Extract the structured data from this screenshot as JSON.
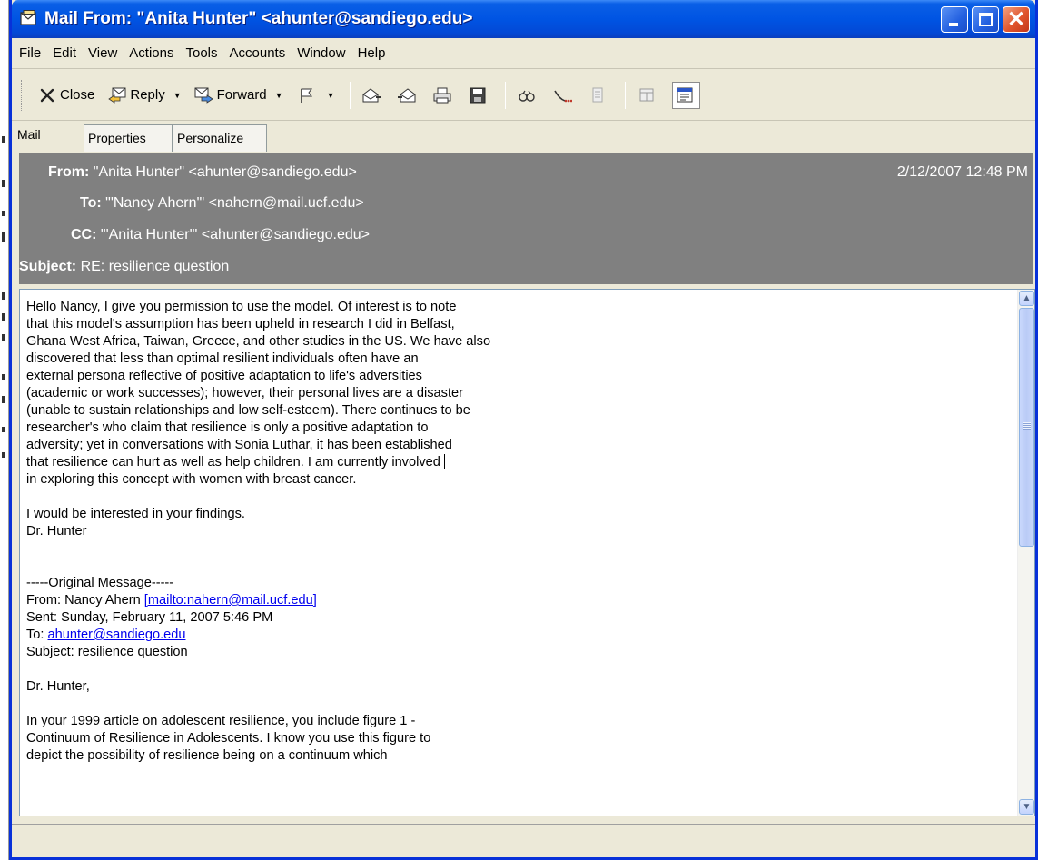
{
  "window": {
    "title": "Mail From: \"Anita Hunter\" <ahunter@sandiego.edu>",
    "close_glyph": "✕"
  },
  "menu": [
    "File",
    "Edit",
    "View",
    "Actions",
    "Tools",
    "Accounts",
    "Window",
    "Help"
  ],
  "toolbar": {
    "close_label": "Close",
    "reply_label": "Reply",
    "forward_label": "Forward"
  },
  "tabs": [
    "Mail",
    "Properties",
    "Personalize"
  ],
  "header": {
    "from_label": "From:",
    "from_value": "\"Anita Hunter\" <ahunter@sandiego.edu>",
    "to_label": "To:",
    "to_value": "\"'Nancy Ahern'\" <nahern@mail.ucf.edu>",
    "cc_label": "CC:",
    "cc_value": "\"'Anita Hunter'\" <ahunter@sandiego.edu>",
    "subject_label": "Subject:",
    "subject_value": "RE: resilience question",
    "date": "2/12/2007 12:48 PM"
  },
  "message": {
    "paragraph1": "Hello Nancy, I give you permission to use the model. Of interest is to note\nthat this model's assumption has been upheld in research I did in Belfast,\nGhana West Africa, Taiwan, Greece, and other studies in the US. We have also\ndiscovered that less than optimal resilient individuals often have an\nexternal persona reflective of positive adaptation to life's adversities\n(academic or work successes); however, their personal lives are a disaster\n(unable to sustain relationships and low self-esteem). There continues to be\nresearcher's who claim that resilience is only a positive adaptation to\nadversity; yet in conversations with Sonia Luthar, it has been established\nthat resilience can hurt as well as help children. I am currently involved",
    "paragraph1_end": "in exploring this concept with women with breast cancer.",
    "closing": "I would be interested in your findings.\nDr. Hunter",
    "original_header": "-----Original Message-----",
    "orig_from_prefix": "From: Nancy Ahern ",
    "orig_from_link": "[mailto:nahern@mail.ucf.edu]",
    "orig_sent": "Sent: Sunday, February 11, 2007 5:46 PM",
    "orig_to_prefix": "To: ",
    "orig_to_link": "ahunter@sandiego.edu",
    "orig_subject": "Subject: resilience question",
    "orig_greeting": "Dr. Hunter,",
    "orig_body": "In your 1999 article on adolescent resilience, you include figure 1 -\nContinuum of Resilience in Adolescents. I know you use this figure to\ndepict the possibility of resilience being on a continuum which"
  }
}
